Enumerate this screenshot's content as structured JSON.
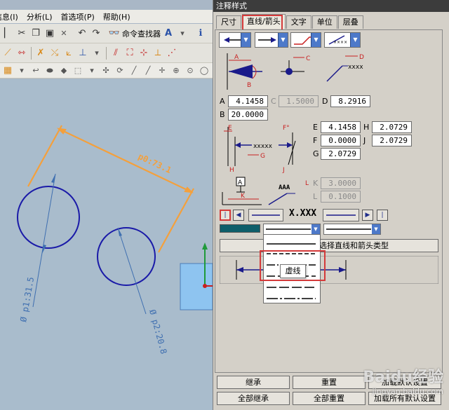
{
  "app": {
    "menu": [
      "信息(I)",
      "分析(L)",
      "首选项(P)",
      "帮助(H)"
    ],
    "toolbar_cmd_finder": "命令查找器",
    "toolbar_text_tool": "A"
  },
  "viewport": {
    "linear_dim": "p0:73.1",
    "dia_dim_1": "Ø p1:31.5",
    "dia_dim_2": "Ø p2:20.8"
  },
  "dialog": {
    "title": "注释样式",
    "tabs": [
      "尺寸",
      "直线/箭头",
      "文字",
      "单位",
      "层叠"
    ],
    "active_tab": "直线/箭头",
    "arrow_diagram_labels": [
      "A",
      "B",
      "C",
      "D",
      "xxxx"
    ],
    "fields": {
      "A": {
        "label": "A",
        "value": "4.1458"
      },
      "C": {
        "label": "C",
        "value": "1.5000"
      },
      "D": {
        "label": "D",
        "value": "8.2916"
      },
      "B": {
        "label": "B",
        "value": "20.0000"
      },
      "E": {
        "label": "E",
        "value": "4.1458"
      },
      "H": {
        "label": "H",
        "value": "2.0729"
      },
      "F": {
        "label": "F",
        "value": "0.0000"
      },
      "J": {
        "label": "J",
        "value": "2.0729"
      },
      "G": {
        "label": "G",
        "value": "2.0729"
      },
      "K": {
        "label": "K",
        "value": "3.0000"
      },
      "L": {
        "label": "L",
        "value": "0.1000"
      }
    },
    "ext_diagram_labels": [
      "E",
      "F°",
      "G",
      "H",
      "J",
      "xxxxx"
    ],
    "leader_diagram_labels": [
      "A",
      "K",
      "AAA",
      "L"
    ],
    "sample_text": "X.XXX",
    "line_type_button": "选择直线和箭头类型",
    "dropdown_options": [
      "实线",
      "短虚线",
      "长短线",
      "虚线",
      "中心线",
      "点划线"
    ],
    "tooltip": "虚线",
    "buttons": {
      "inherit": "继承",
      "reset": "重置",
      "load_default": "加载默认设置",
      "inherit_all": "全部继承",
      "reset_all": "全部重置",
      "load_all_default": "加载所有默认设置"
    },
    "color_swatch": "#0e5e6a"
  },
  "colors": {
    "accent_red": "#d43a3a",
    "dim_orange": "#f4a03c",
    "circle_blue": "#1a1aa8",
    "dropdown_blue": "#4d79c9",
    "dialog_bg": "#d4d0c8"
  },
  "watermark": {
    "brand": "Baidu经验",
    "url": "jingyan.baidu.com"
  }
}
